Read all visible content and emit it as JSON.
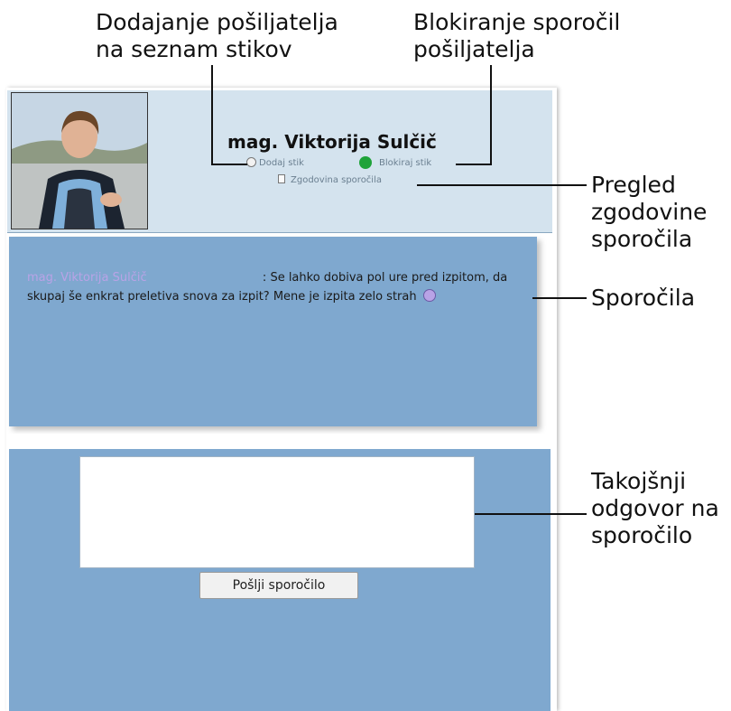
{
  "callouts": {
    "add_contact": "Dodajanje pošiljatelja\nna seznam stikov",
    "block": "Blokiranje sporočil\npošiljatelja",
    "history": "Pregled\nzgodovine\nsporočila",
    "messages": "Sporočila",
    "reply": "Takojšnji\nodgovor na\nsporočilo"
  },
  "header": {
    "contact_name": "mag. Viktorija Sulčič",
    "add_contact_link": "Dodaj stik",
    "block_link": "Blokiraj stik",
    "history_link": "Zgodovina sporočila"
  },
  "message": {
    "sender": "mag. Viktorija Sulčič",
    "separator": ":",
    "text": "Se lahko dobiva pol ure pred izpitom, da skupaj še enkrat preletiva snova za izpit? Mene je izpita zelo strah"
  },
  "reply": {
    "input_value": "",
    "send_label": "Pošlji sporočilo"
  },
  "colors": {
    "header_bg": "#d4e3ee",
    "panel_blue": "#7fa8cf",
    "status_online": "#1fa33a",
    "sender_purple": "#b9a3e6"
  },
  "icons": {
    "add_contact": "add-contact-icon",
    "block": "status-dot-icon",
    "history": "history-icon",
    "emoticon": "sad-face-icon"
  }
}
